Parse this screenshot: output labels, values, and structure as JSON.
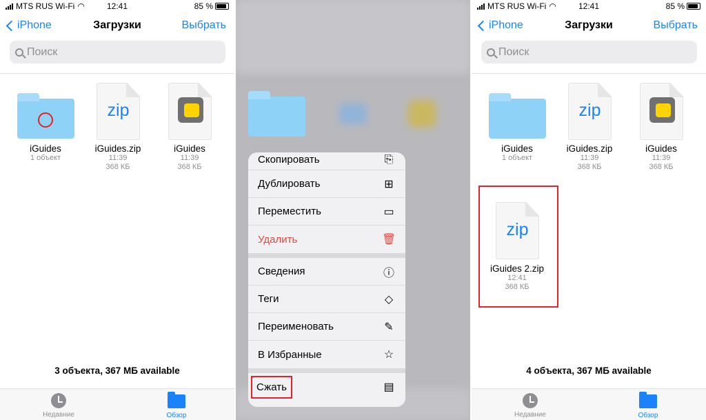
{
  "status": {
    "carrier": "MTS RUS Wi-Fi",
    "time": "12:41",
    "battery": "85 %",
    "battery_level": 0.85
  },
  "nav": {
    "back": "iPhone",
    "title": "Загрузки",
    "select": "Выбрать"
  },
  "search": {
    "placeholder": "Поиск"
  },
  "items": [
    {
      "name": "iGuides",
      "meta1": "1 объект",
      "icon": "folder-icon"
    },
    {
      "name": "iGuides.zip",
      "meta1": "11:39",
      "meta2": "368 КБ",
      "icon": "zip-icon",
      "zip": "zip"
    },
    {
      "name": "iGuides",
      "meta1": "11:39",
      "meta2": "368 КБ",
      "icon": "app-file-icon"
    }
  ],
  "new_item": {
    "name": "iGuides 2.zip",
    "meta1": "12:41",
    "meta2": "368 КБ",
    "zip": "zip"
  },
  "footer1": "3 объекта, 367 МБ available",
  "footer3": "4 объекта, 367 МБ available",
  "tabs": [
    {
      "label": "Недавние",
      "icon": "clock-icon"
    },
    {
      "label": "Обзор",
      "icon": "folder-icon",
      "active": true
    }
  ],
  "menu": [
    {
      "label": "Скопировать",
      "icon": "copy-icon",
      "glyph": "⎘"
    },
    {
      "label": "Дублировать",
      "icon": "duplicate-icon",
      "glyph": "⊞"
    },
    {
      "label": "Переместить",
      "icon": "folder-icon",
      "glyph": "▭"
    },
    {
      "label": "Удалить",
      "icon": "trash-icon",
      "glyph": "🗑",
      "destructive": true
    },
    {
      "label": "Сведения",
      "icon": "info-icon",
      "glyph": "ⓘ"
    },
    {
      "label": "Теги",
      "icon": "tag-icon",
      "glyph": "◇"
    },
    {
      "label": "Переименовать",
      "icon": "edit-icon",
      "glyph": "✎"
    },
    {
      "label": "В Избранные",
      "icon": "star-icon",
      "glyph": "☆"
    },
    {
      "label": "Сжать",
      "icon": "archive-icon",
      "glyph": "▤"
    }
  ],
  "colors": {
    "accent": "#1a82fb",
    "destructive": "#e8453c",
    "highlight": "#e8202a"
  }
}
